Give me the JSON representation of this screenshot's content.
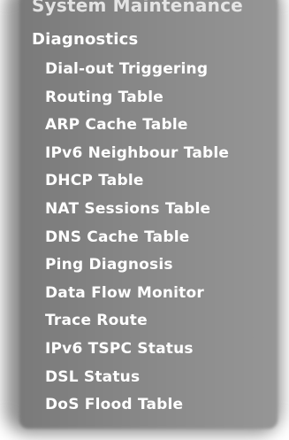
{
  "menu": {
    "header": "System Maintenance",
    "section_title": "Diagnostics",
    "items": [
      {
        "label": "Dial-out Triggering"
      },
      {
        "label": "Routing Table"
      },
      {
        "label": "ARP Cache Table"
      },
      {
        "label": "IPv6 Neighbour Table"
      },
      {
        "label": "DHCP Table"
      },
      {
        "label": "NAT Sessions Table"
      },
      {
        "label": "DNS Cache Table"
      },
      {
        "label": "Ping Diagnosis"
      },
      {
        "label": "Data Flow Monitor"
      },
      {
        "label": "Trace Route"
      },
      {
        "label": "IPv6 TSPC Status"
      },
      {
        "label": "DSL Status"
      },
      {
        "label": "DoS Flood Table"
      }
    ]
  },
  "colors": {
    "panel": "#8a8a8a",
    "text": "#ffffff",
    "background": "#ffffff"
  }
}
